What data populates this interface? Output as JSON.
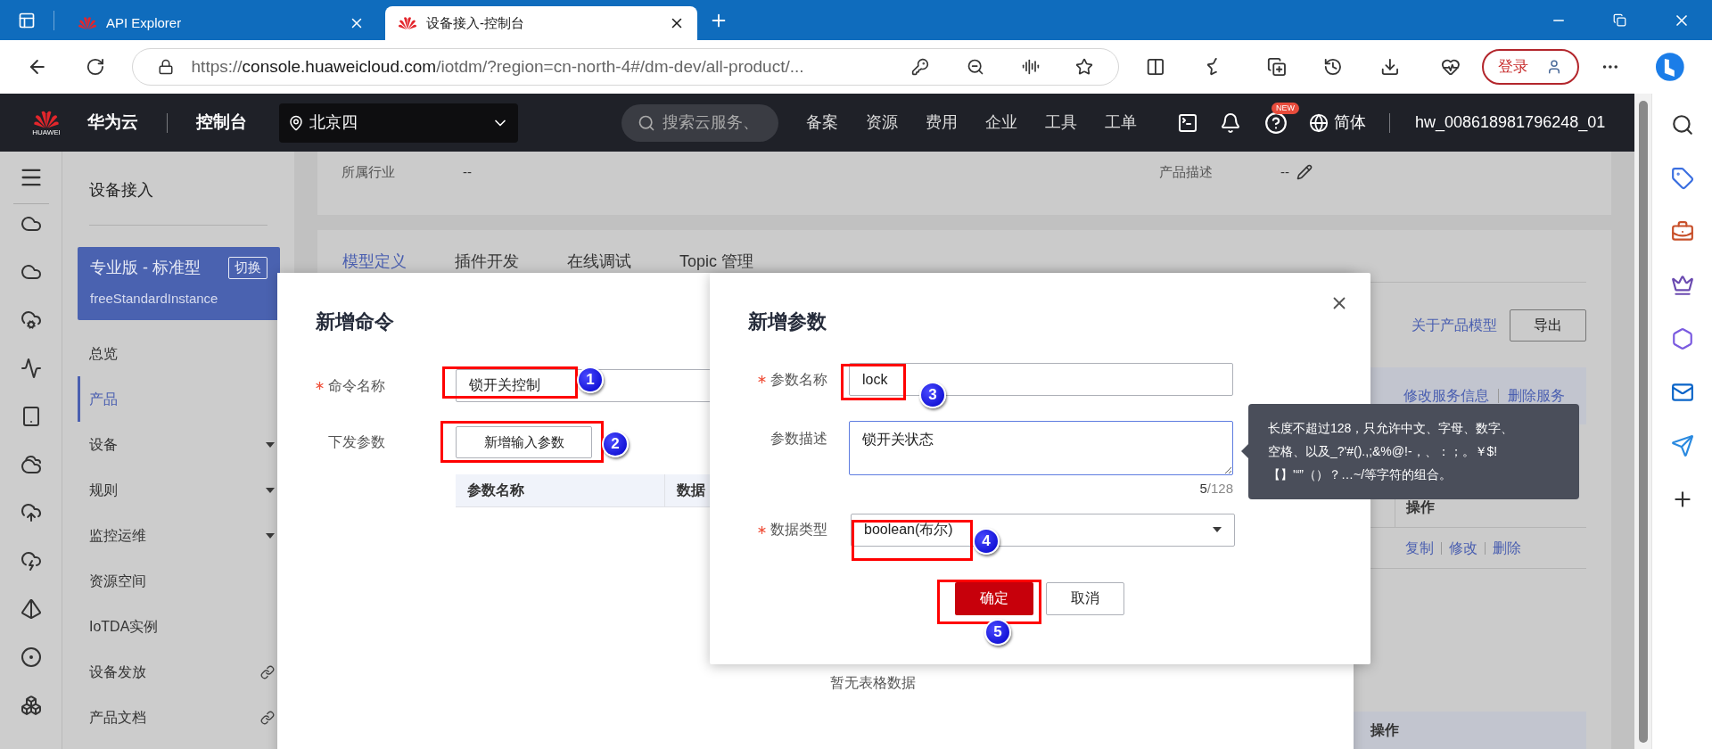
{
  "browser": {
    "tabs": [
      {
        "title": "API Explorer",
        "selected": false
      },
      {
        "title": "设备接入-控制台",
        "selected": true
      }
    ],
    "address": {
      "scheme": "https://",
      "host": "console.huaweicloud.com",
      "path": "/iotdm/?region=cn-north-4#/dm-dev/all-product/..."
    },
    "login_button": "登录"
  },
  "header": {
    "logo_text": "HUAWEI",
    "brand": "华为云",
    "console": "控制台",
    "region": "北京四",
    "search_placeholder": "搜索云服务、",
    "nav": [
      "备案",
      "资源",
      "费用",
      "企业",
      "工具",
      "工单"
    ],
    "new_badge": "NEW",
    "language": "简体",
    "user": "hw_008618981796248_01"
  },
  "sidebar": {
    "title": "设备接入",
    "instance": {
      "edition": "专业版 - 标准型",
      "switch_button": "切换",
      "name": "freeStandardInstance"
    },
    "items": [
      {
        "label": "总览",
        "kind": "plain",
        "selected": false
      },
      {
        "label": "产品",
        "kind": "plain",
        "selected": true
      },
      {
        "label": "设备",
        "kind": "expandable",
        "selected": false
      },
      {
        "label": "规则",
        "kind": "expandable",
        "selected": false
      },
      {
        "label": "监控运维",
        "kind": "expandable",
        "selected": false
      },
      {
        "label": "资源空间",
        "kind": "plain",
        "selected": false
      },
      {
        "label": "IoTDA实例",
        "kind": "plain",
        "selected": false
      },
      {
        "label": "设备发放",
        "kind": "external",
        "selected": false
      },
      {
        "label": "产品文档",
        "kind": "external",
        "selected": false
      }
    ]
  },
  "product_info": {
    "fields": [
      {
        "label": "所属行业",
        "value": "--",
        "editable": false
      },
      {
        "label": "产品描述",
        "value": "--",
        "editable": true
      }
    ]
  },
  "tabs": [
    {
      "label": "模型定义",
      "selected": true
    },
    {
      "label": "插件开发",
      "selected": false
    },
    {
      "label": "在线调试",
      "selected": false
    },
    {
      "label": "Topic 管理",
      "selected": false
    }
  ],
  "model_toolbar": {
    "link": "关于产品模型",
    "export_button": "导出"
  },
  "service_actions": [
    "修改服务信息",
    "删除服务"
  ],
  "command_table": {
    "action_header": "操作",
    "row_actions": [
      "复制",
      "修改",
      "删除"
    ]
  },
  "lower_table": {
    "action_header": "操作"
  },
  "command_dialog": {
    "title": "新增命令",
    "name": {
      "label": "命令名称",
      "required": true,
      "value": "锁开关控制"
    },
    "params": {
      "label": "下发参数",
      "required": false,
      "button": "新增输入参数"
    },
    "table": {
      "columns": [
        "参数名称",
        "数据"
      ],
      "empty_text": "暂无表格数据"
    }
  },
  "param_dialog": {
    "title": "新增参数",
    "name": {
      "label": "参数名称",
      "required": true,
      "value": "lock"
    },
    "description": {
      "label": "参数描述",
      "required": false,
      "value": "锁开关状态",
      "focused": true,
      "count": "5",
      "limit": "/128"
    },
    "data_type": {
      "label": "数据类型",
      "required": true,
      "value": "boolean(布尔)"
    },
    "confirm_button": "确定",
    "cancel_button": "取消"
  },
  "tooltip": {
    "lines": [
      "长度不超过128，只允许中文、字母、数字、",
      "空格、以及_?'#().,;&%@!-，、：；。￥$!",
      "【】'“”（）？…~/等字符的组合。"
    ]
  },
  "annotations": [
    {
      "label": "1"
    },
    {
      "label": "2"
    },
    {
      "label": "3"
    },
    {
      "label": "4"
    },
    {
      "label": "5"
    }
  ]
}
